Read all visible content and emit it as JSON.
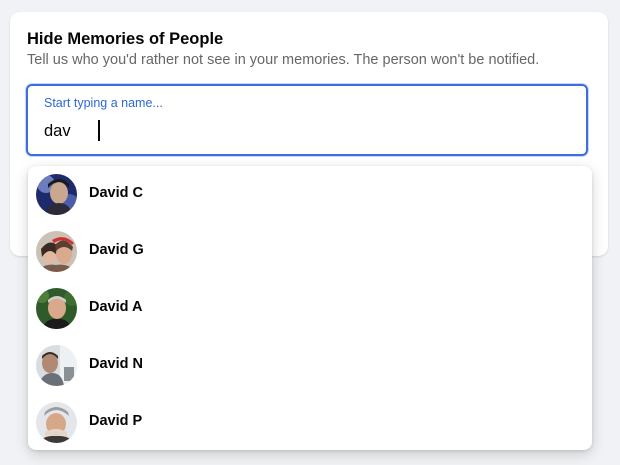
{
  "dialog": {
    "title": "Hide Memories of People",
    "subtitle": "Tell us who you'd rather not see in your memories. The person won't be notified."
  },
  "search": {
    "label": "Start typing a name...",
    "value": "dav"
  },
  "suggestions": [
    {
      "name": "David C",
      "avatar": "profile-photo-icon"
    },
    {
      "name": "David G",
      "avatar": "profile-photo-icon"
    },
    {
      "name": "David A",
      "avatar": "profile-photo-icon"
    },
    {
      "name": "David N",
      "avatar": "profile-photo-icon"
    },
    {
      "name": "David P",
      "avatar": "profile-photo-icon"
    }
  ],
  "colors": {
    "accent": "#3a6fdc",
    "label_blue": "#2e68d6",
    "background": "#f0f2f5"
  }
}
